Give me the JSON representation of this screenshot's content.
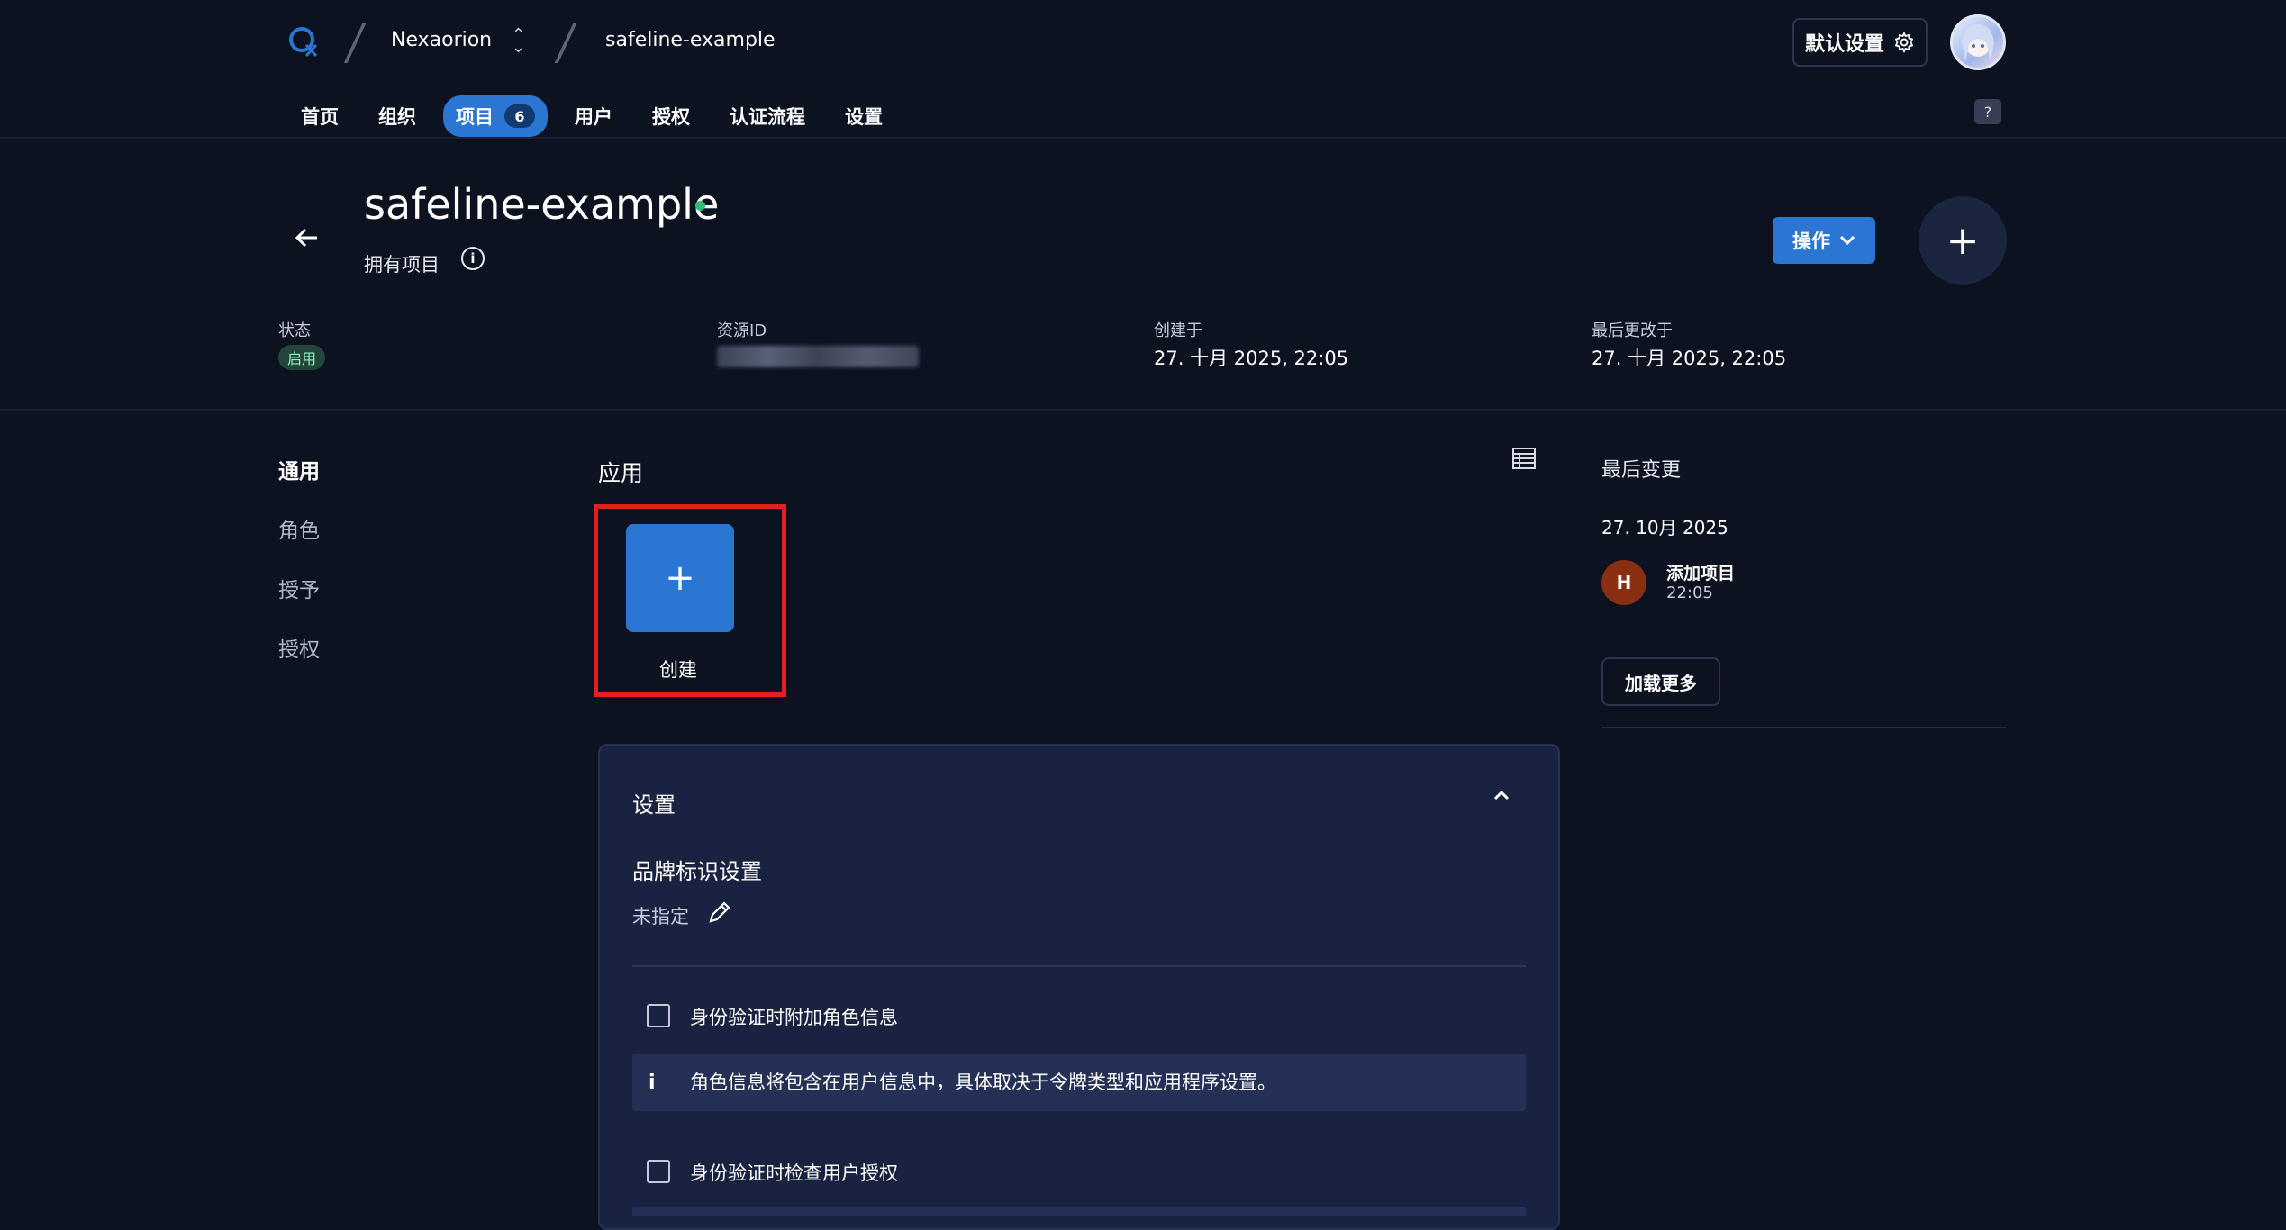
{
  "topbar": {
    "org_name": "Nexaorion",
    "project_name": "safeline-example",
    "defaults_label": "默认设置",
    "help_label": "?"
  },
  "nav": {
    "items": [
      {
        "label": "首页"
      },
      {
        "label": "组织"
      },
      {
        "label": "项目",
        "badge": "6"
      },
      {
        "label": "用户"
      },
      {
        "label": "授权"
      },
      {
        "label": "认证流程"
      },
      {
        "label": "设置"
      }
    ]
  },
  "header": {
    "title": "safeline-example",
    "subtitle": "拥有项目",
    "actions_label": "操作",
    "add_label": "+"
  },
  "meta": {
    "state_label": "状态",
    "state_value": "启用",
    "resource_id_label": "资源ID",
    "created_label": "创建于",
    "created_value": "27. 十月 2025, 22:05",
    "modified_label": "最后更改于",
    "modified_value": "27. 十月 2025, 22:05"
  },
  "sidenav": {
    "items": [
      "通用",
      "角色",
      "授予",
      "授权"
    ]
  },
  "apps": {
    "title": "应用",
    "create_label": "创建",
    "create_symbol": "+"
  },
  "settings": {
    "title": "设置",
    "brand_title": "品牌标识设置",
    "brand_value": "未指定",
    "check1_label": "身份验证时附加角色信息",
    "info_text": "角色信息将包含在用户信息中，具体取决于令牌类型和应用程序设置。",
    "info_icon": "i",
    "check2_label": "身份验证时检查用户授权"
  },
  "activity": {
    "title": "最后变更",
    "date": "27. 10月 2025",
    "avatar_initial": "H",
    "item": "添加项目",
    "time": "22:05",
    "load_more": "加载更多"
  },
  "colors": {
    "background": "#0d1221",
    "accent": "#2a76d2",
    "status_green": "#2dbd7a",
    "highlight": "#e51e1e"
  }
}
